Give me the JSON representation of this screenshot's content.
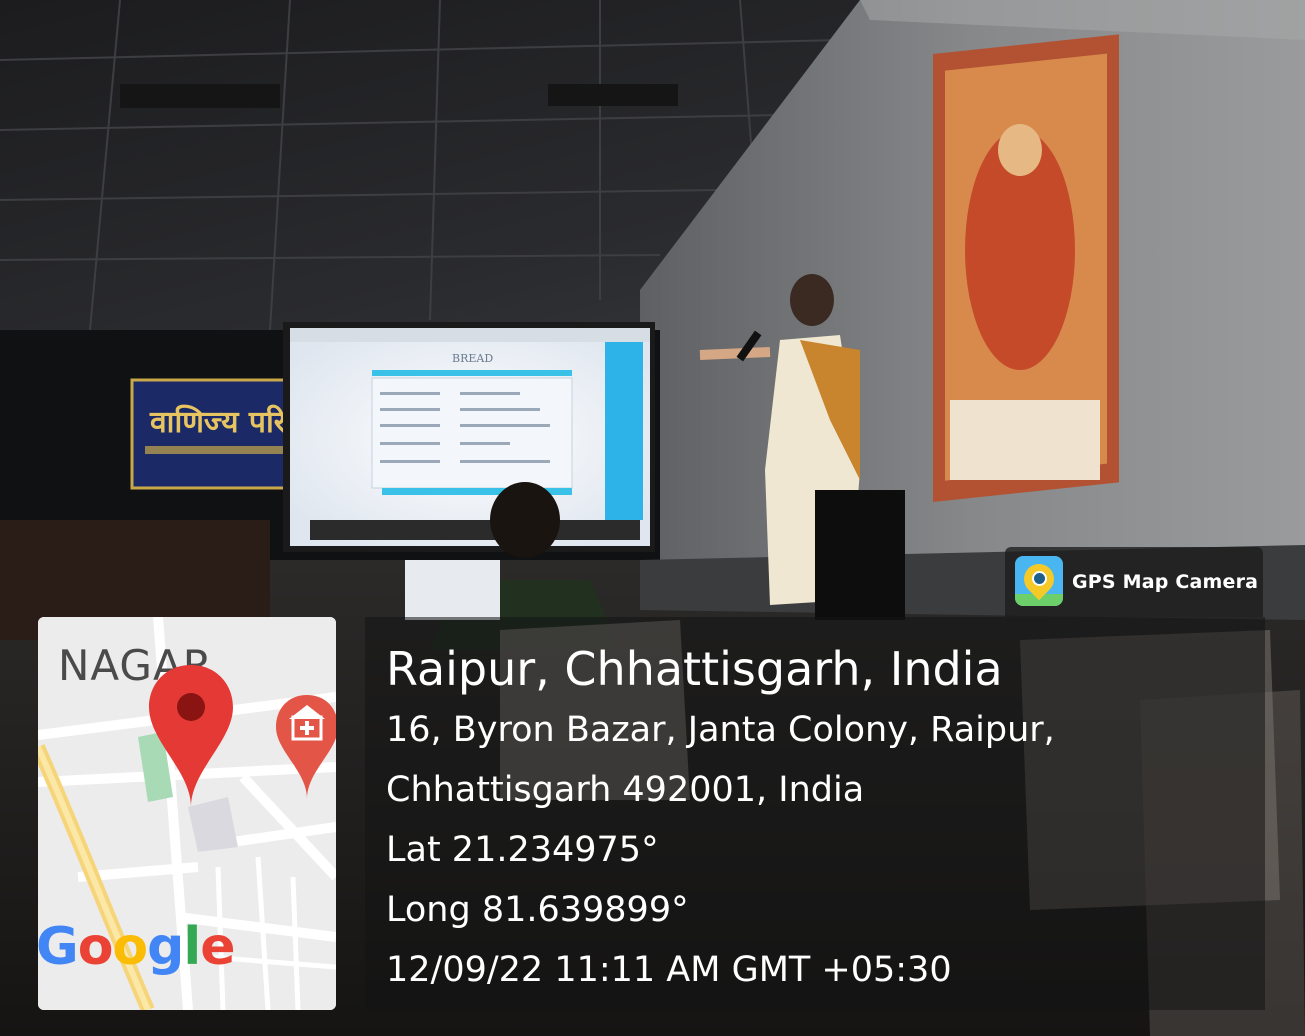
{
  "watermark": {
    "brand_label": "GPS Map Camera",
    "brand_icon": "gps-map-camera-app-icon"
  },
  "map": {
    "area_label": "NAGAR",
    "logo_letters": [
      {
        "ch": "G",
        "color": "#4285F4"
      },
      {
        "ch": "o",
        "color": "#EA4335"
      },
      {
        "ch": "o",
        "color": "#FBBC05"
      },
      {
        "ch": "g",
        "color": "#4285F4"
      },
      {
        "ch": "l",
        "color": "#34A853"
      },
      {
        "ch": "e",
        "color": "#EA4335"
      }
    ],
    "pin_color": "#e53935",
    "hospital_icon": "hospital-icon"
  },
  "location": {
    "city": "Raipur, Chhattisgarh, India",
    "address_line1": "16, Byron Bazar, Janta Colony, Raipur,",
    "address_line2": "Chhattisgarh 492001, India",
    "latitude": "Lat 21.234975°",
    "longitude": "Long 81.639899°",
    "timestamp": "12/09/22 11:11 AM GMT +05:30"
  },
  "scene": {
    "projector_slide_title": "BREAD",
    "banner_text": "वाणिज्य परि"
  }
}
